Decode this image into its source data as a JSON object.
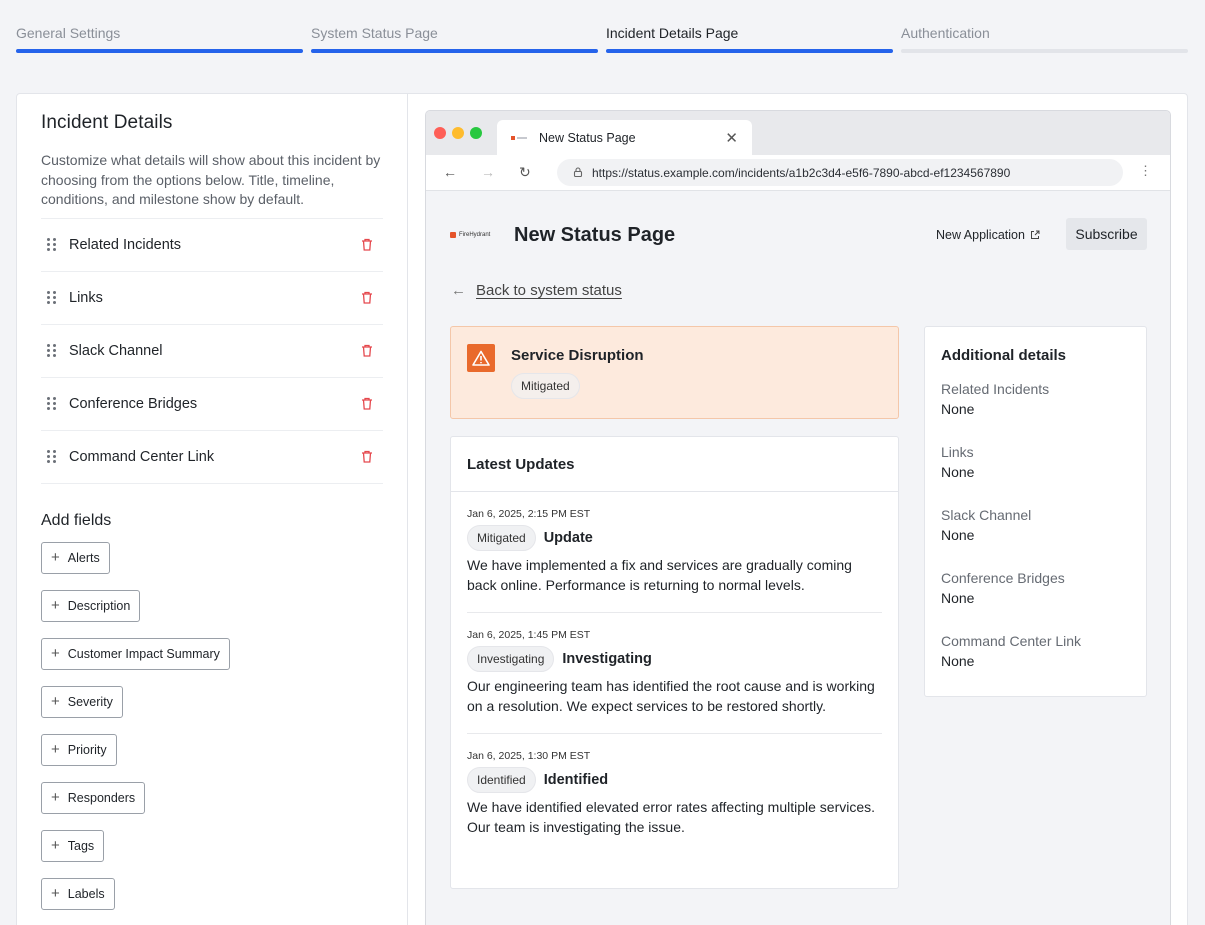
{
  "steps": [
    {
      "label": "General Settings"
    },
    {
      "label": "System Status Page"
    },
    {
      "label": "Incident Details Page"
    },
    {
      "label": "Authentication"
    }
  ],
  "panel": {
    "title": "Incident Details",
    "description": "Customize what details will show about this incident by choosing from the options below. Title, timeline, conditions, and milestone show by default.",
    "items": [
      {
        "label": "Related Incidents"
      },
      {
        "label": "Links"
      },
      {
        "label": "Slack Channel"
      },
      {
        "label": "Conference Bridges"
      },
      {
        "label": "Command Center Link"
      }
    ],
    "add_title": "Add fields",
    "add_fields": [
      "Alerts",
      "Description",
      "Customer Impact Summary",
      "Severity",
      "Priority",
      "Responders",
      "Tags",
      "Labels"
    ]
  },
  "browser": {
    "tab_title": "New Status Page",
    "url": "https://status.example.com/incidents/a1b2c3d4-e5f6-7890-abcd-ef1234567890"
  },
  "status_page": {
    "brand": "FireHydrant",
    "title": "New Status Page",
    "new_app": "New Application",
    "subscribe": "Subscribe",
    "back": "Back to system status",
    "alert_title": "Service Disruption",
    "alert_status": "Mitigated",
    "updates_title": "Latest Updates",
    "updates": [
      {
        "time": "Jan 6, 2025, 2:15 PM EST",
        "status": "Mitigated",
        "title": "Update",
        "body": "We have implemented a fix and services are gradually coming back online. Performance is returning to normal levels."
      },
      {
        "time": "Jan 6, 2025, 1:45 PM EST",
        "status": "Investigating",
        "title": "Investigating",
        "body": "Our engineering team has identified the root cause and is working on a resolution. We expect services to be restored shortly."
      },
      {
        "time": "Jan 6, 2025, 1:30 PM EST",
        "status": "Identified",
        "title": "Identified",
        "body": "We have identified elevated error rates affecting multiple services. Our team is investigating the issue."
      }
    ],
    "details_title": "Additional details",
    "details": [
      {
        "label": "Related Incidents",
        "value": "None"
      },
      {
        "label": "Links",
        "value": "None"
      },
      {
        "label": "Slack Channel",
        "value": "None"
      },
      {
        "label": "Conference Bridges",
        "value": "None"
      },
      {
        "label": "Command Center Link",
        "value": "None"
      }
    ]
  },
  "colors": {
    "accent": "#2563eb",
    "warning": "#e96a2c",
    "delete": "#e5484d"
  }
}
